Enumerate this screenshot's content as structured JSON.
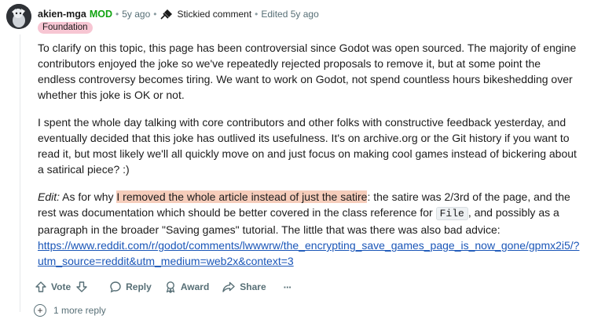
{
  "comment": {
    "author": "akien-mga",
    "mod_badge": "MOD",
    "age": "5y ago",
    "sticky_label": "Stickied comment",
    "edited": "Edited 5y ago",
    "flair": "Foundation",
    "paragraphs": [
      "To clarify on this topic, this page has been controversial since Godot was open sourced. The majority of engine contributors enjoyed the joke so we've repeatedly rejected proposals to remove it, but at some point the endless controversy becomes tiring. We want to work on Godot, not spend countless hours bikeshedding over whether this joke is OK or not.",
      "I spent the whole day talking with core contributors and other folks with constructive feedback yesterday, and eventually decided that this joke has outlived its usefulness. It's on archive.org or the Git history if you want to read it, but most likely we'll all quickly move on and just focus on making cool games instead of bickering about a satirical piece? :)"
    ],
    "edit_para": {
      "label": "Edit:",
      "pre": " As for why ",
      "highlight": "I removed the whole article instead of just the satire",
      "mid": ": the satire was 2/3rd of the page, and the rest was documentation which should be better covered in the class reference for ",
      "code": "File",
      "post": ", and possibly as a paragraph in the broader \"Saving games\" tutorial. The little that was there was also bad advice:",
      "link": "https://www.reddit.com/r/godot/comments/lwwwrw/the_encrypting_save_games_page_is_now_gone/gpmx2i5/?utm_source=reddit&utm_medium=web2x&context=3"
    }
  },
  "actions": {
    "vote": "Vote",
    "reply": "Reply",
    "award": "Award",
    "share": "Share",
    "more": "···"
  },
  "more_replies": {
    "icon": "+",
    "label": "1 more reply"
  }
}
